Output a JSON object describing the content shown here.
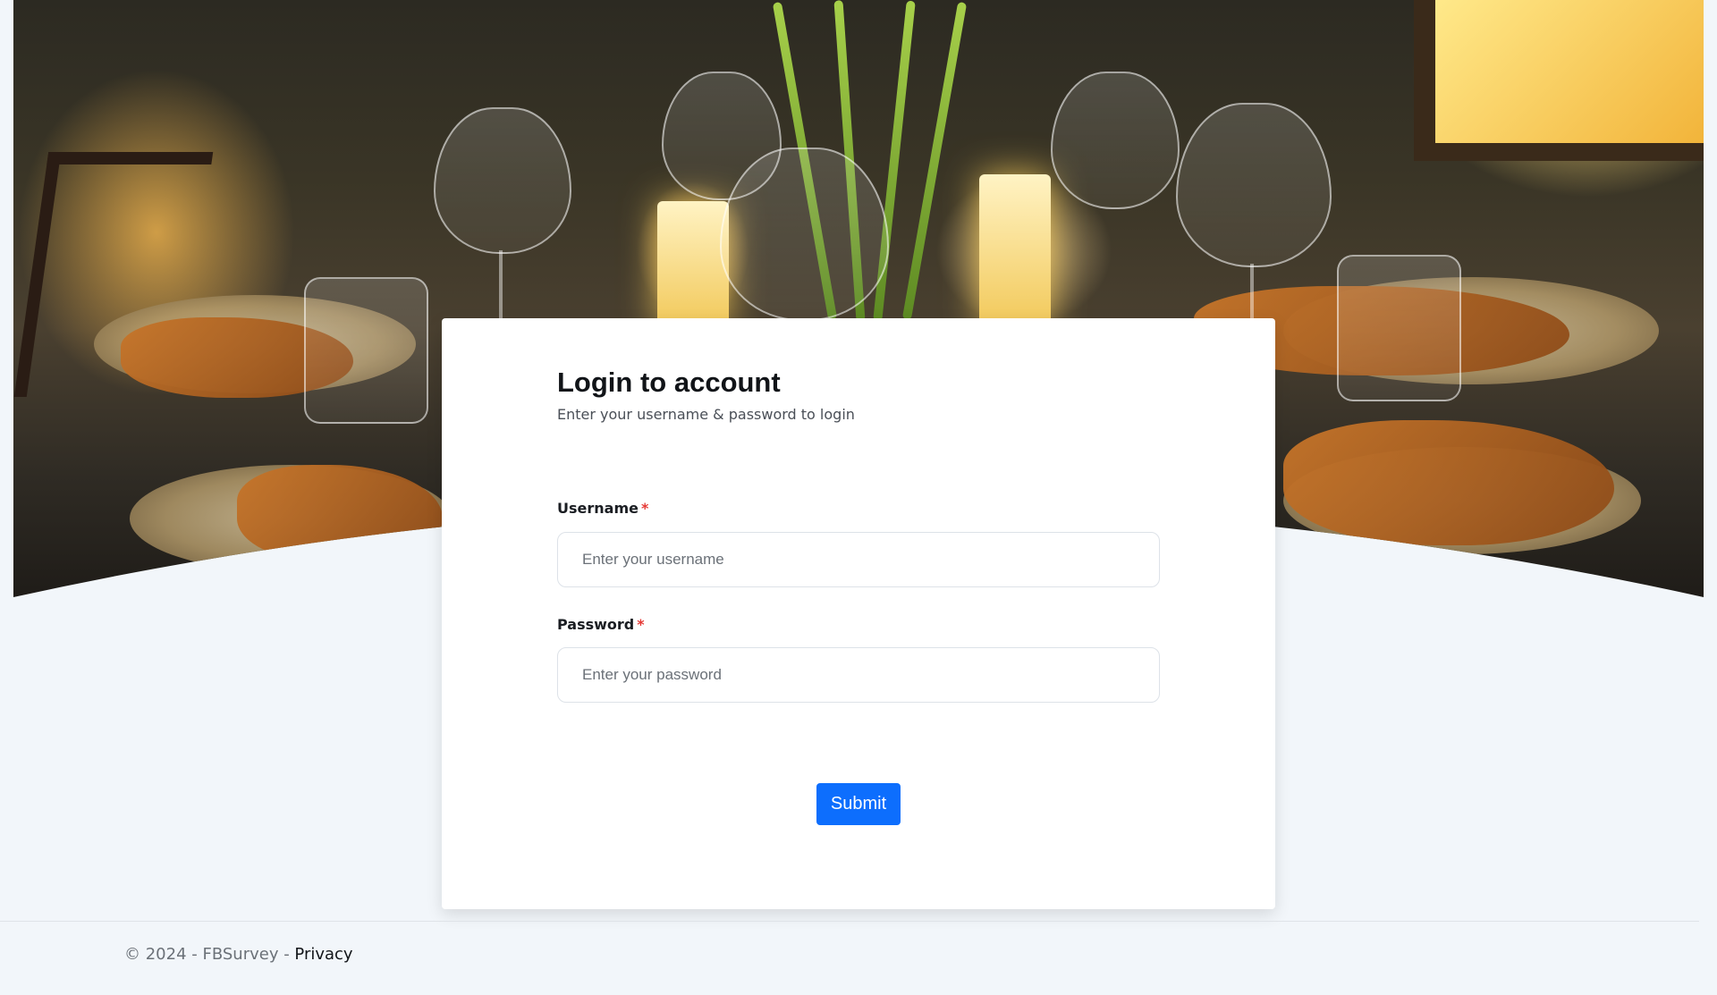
{
  "login": {
    "title": "Login to account",
    "subtitle": "Enter your username & password to login",
    "username": {
      "label": "Username",
      "required_marker": "*",
      "placeholder": "Enter your username",
      "value": ""
    },
    "password": {
      "label": "Password",
      "required_marker": "*",
      "placeholder": "Enter your password",
      "value": ""
    },
    "submit_label": "Submit"
  },
  "footer": {
    "copyright": "© 2024 - FBSurvey - ",
    "privacy_link": "Privacy"
  },
  "colors": {
    "primary_button": "#0d6efd",
    "required_star": "#e53935",
    "page_background": "#f2f6fa",
    "card_background": "#ffffff"
  }
}
